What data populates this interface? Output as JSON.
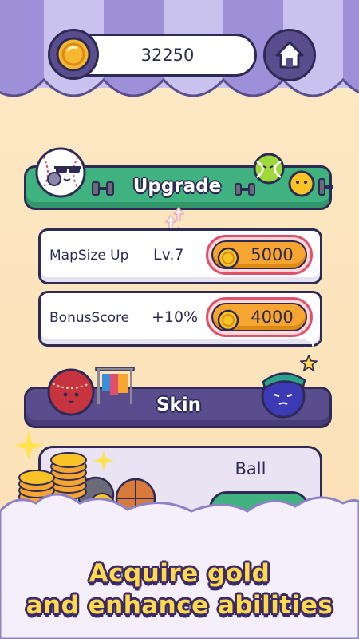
{
  "header": {
    "coin_count": "32250",
    "home_icon": "home-icon",
    "coin_icon": "gold-coin-icon"
  },
  "upgrade": {
    "title": "Upgrade",
    "rows": [
      {
        "label": "MapSize Up",
        "level": "Lv.7",
        "price": "5000"
      },
      {
        "label": "BonusScore",
        "level": "+10%",
        "price": "4000"
      }
    ]
  },
  "skin": {
    "title": "Skin"
  },
  "ball_card": {
    "label": "Ball"
  },
  "promo": {
    "line1": "Acquire gold",
    "line2": "and enhance abilities"
  },
  "colors": {
    "background": "#fce5bf",
    "awning_purple": "#9d90d8",
    "awning_light": "#ffffff",
    "upgrade_green": "#3fb27f",
    "skin_purple": "#5a4d8e",
    "price_orange": "#f6a531",
    "caption_yellow": "#ffd949",
    "outline": "#2d2a55"
  }
}
